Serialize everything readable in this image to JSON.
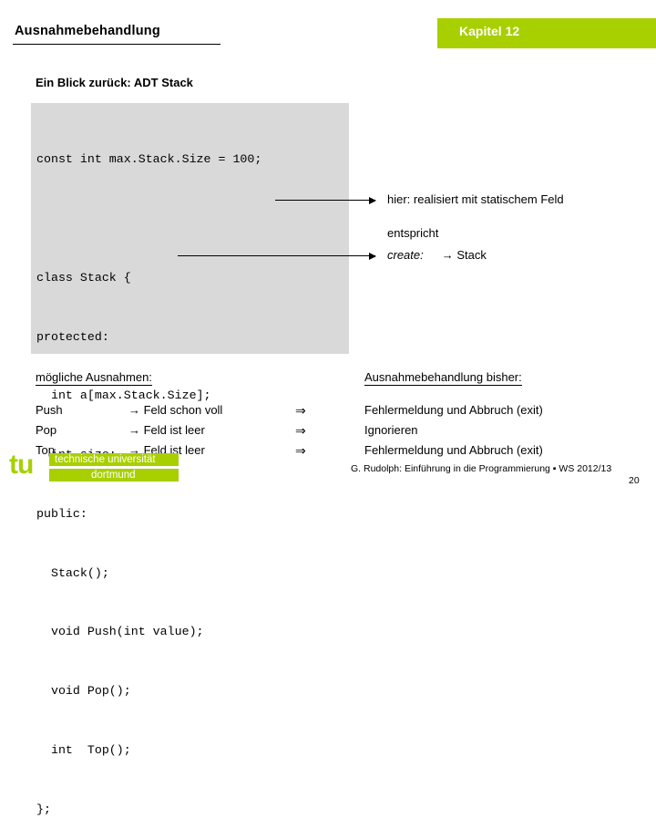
{
  "header": {
    "title": "Ausnahmebehandlung",
    "chapter": "Kapitel 12"
  },
  "subtitle": "Ein Blick zurück: ADT Stack",
  "code": {
    "lines": [
      "const int max.Stack.Size = 100;",
      "",
      "class Stack {",
      "protected:",
      "  int a[max.Stack.Size];",
      "  int size;",
      "public:",
      "  Stack();",
      "  void Push(int value);",
      "  void Pop();",
      "  int  Top();",
      "};"
    ]
  },
  "annotations": {
    "field_note": "hier: realisiert mit statischem Feld",
    "corresponds": "entspricht",
    "create_label": "create:",
    "create_target": "→ Stack"
  },
  "tables": {
    "left_heading": "mögliche Ausnahmen:",
    "right_heading": "Ausnahmebehandlung bisher:",
    "rows": [
      {
        "operation": "Push",
        "exception": "→ Feld schon voll",
        "implies": "⇒",
        "handling": "Fehlermeldung und Abbruch (exit)"
      },
      {
        "operation": "Pop",
        "exception": "→ Feld ist leer",
        "implies": "⇒",
        "handling": "Ignorieren"
      },
      {
        "operation": "Top",
        "exception": "→ Feld ist leer",
        "implies": "⇒",
        "handling": "Fehlermeldung und Abbruch (exit)"
      }
    ]
  },
  "logo": {
    "tu": "tu",
    "line1": "technische universität",
    "line2": "dortmund"
  },
  "footer": {
    "credit": "G. Rudolph: Einführung in die Programmierung ▪ WS 2012/13",
    "page": "20"
  },
  "colors": {
    "accent": "#a8cf00",
    "code_bg": "#d9d9d9"
  }
}
